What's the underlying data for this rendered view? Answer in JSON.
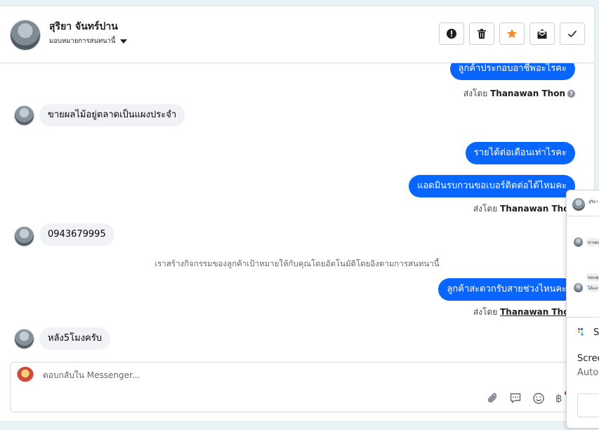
{
  "header": {
    "contact_name": "สุริยา จันทร์ปาน",
    "assignment_label": "มอบหมายการสนทนานี้",
    "buttons": [
      {
        "name": "report-button",
        "icon": "exclamation-circle-icon"
      },
      {
        "name": "delete-button",
        "icon": "trash-icon"
      },
      {
        "name": "star-button",
        "icon": "star-icon",
        "color": "#f28a2e"
      },
      {
        "name": "mark-unread-button",
        "icon": "envelope-icon"
      },
      {
        "name": "mark-done-button",
        "icon": "checkmark-icon"
      }
    ]
  },
  "messages": {
    "m1": {
      "text": "ลูกค้าประกอบอาชีพอะไรคะ",
      "direction": "outgoing"
    },
    "m1_sent_prefix": "ส่งโดย",
    "m1_sender": "Thanawan Thon",
    "m2": {
      "text": "ขายผลไม้อยู่ตลาดเป็นแผงประจำ",
      "direction": "incoming"
    },
    "m3": {
      "text": "รายได้ต่อเดือนเท่าไรคะ",
      "direction": "outgoing"
    },
    "m4": {
      "text": "แอดมินรบกวนขอเบอร์ติดต่อได้ไหมคะ",
      "direction": "outgoing"
    },
    "m4_sent_prefix": "ส่งโดย",
    "m4_sender": "Thanawan Thon",
    "m5": {
      "text": "0943679995",
      "direction": "incoming"
    },
    "system_note": "เราสร้างกิจกรรมของลูกค้าเป้าหมายให้กับคุณโดยอัตโนมัติโดยอิงตามการสนทนานี้",
    "m6": {
      "text": "ลูกค้าสะดวกรับสายช่วงไหนคะ",
      "direction": "outgoing"
    },
    "m6_sent_prefix": "ส่งโดย",
    "m6_sender": "Thanawan Thon",
    "m7": {
      "text": "หลัง5โมงครับ",
      "direction": "incoming"
    }
  },
  "composer": {
    "placeholder": "ตอบกลับใน Messenger...",
    "icons": [
      "paperclip-icon",
      "saved-reply-icon",
      "emoji-icon",
      "baht-icon"
    ],
    "baht_symbol": "฿"
  },
  "popup": {
    "title_letter": "S",
    "line1": "Scree",
    "line2": "Auto",
    "mini_text_1": "สุริยา จัน",
    "mini_text_2": "ขายผลไ",
    "mini_text_3": "ขอบคุ",
    "mini_text_4": "ได้แล"
  },
  "colors": {
    "accent": "#0866ff",
    "incoming_bubble": "#f0f2f5",
    "star": "#f28a2e"
  }
}
